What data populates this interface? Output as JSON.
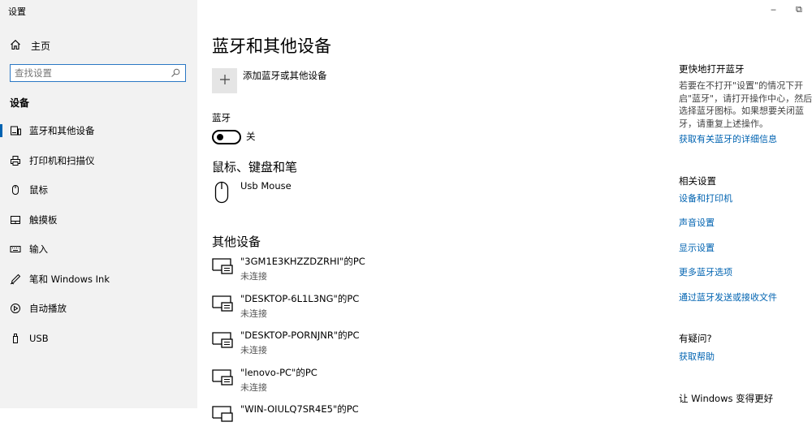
{
  "app": {
    "title": "设置"
  },
  "window_controls": {
    "minimize": "‒",
    "restore": "⧉"
  },
  "sidebar": {
    "home_label": "主页",
    "search_placeholder": "查找设置",
    "section_label": "设备",
    "items": [
      {
        "label": "蓝牙和其他设备",
        "icon": "bluetooth-devices-icon",
        "active": true
      },
      {
        "label": "打印机和扫描仪",
        "icon": "printer-icon"
      },
      {
        "label": "鼠标",
        "icon": "mouse-icon"
      },
      {
        "label": "触摸板",
        "icon": "touchpad-icon"
      },
      {
        "label": "输入",
        "icon": "keyboard-icon"
      },
      {
        "label": "笔和 Windows Ink",
        "icon": "pen-icon"
      },
      {
        "label": "自动播放",
        "icon": "autoplay-icon"
      },
      {
        "label": "USB",
        "icon": "usb-icon"
      }
    ]
  },
  "main": {
    "title": "蓝牙和其他设备",
    "add_device_label": "添加蓝牙或其他设备",
    "bluetooth_label": "蓝牙",
    "bluetooth_state": "关",
    "mouse_section_title": "鼠标、键盘和笔",
    "mouse_device": "Usb Mouse",
    "other_section_title": "其他设备",
    "other_devices": [
      {
        "name": "\"3GM1E3KHZZDZRHI\"的PC",
        "status": "未连接"
      },
      {
        "name": "\"DESKTOP-6L1L3NG\"的PC",
        "status": "未连接"
      },
      {
        "name": "\"DESKTOP-PORNJNR\"的PC",
        "status": "未连接"
      },
      {
        "name": "\"lenovo-PC\"的PC",
        "status": "未连接"
      },
      {
        "name": "\"WIN-OIULQ7SR4E5\"的PC",
        "status": ""
      }
    ]
  },
  "right_panel": {
    "quick_title": "更快地打开蓝牙",
    "quick_text": "若要在不打开\"设置\"的情况下开启\"蓝牙\"，请打开操作中心，然后选择蓝牙图标。如果想要关闭蓝牙，请重复上述操作。",
    "quick_link": "获取有关蓝牙的详细信息",
    "related_title": "相关设置",
    "related_links": [
      "设备和打印机",
      "声音设置",
      "显示设置",
      "更多蓝牙选项",
      "通过蓝牙发送或接收文件"
    ],
    "help_title": "有疑问?",
    "help_link": "获取帮助",
    "feedback_title": "让 Windows 变得更好"
  },
  "colors": {
    "accent": "#0063b1",
    "sidebar_bg": "#f2f2f2",
    "search_border": "#2b78c4"
  }
}
